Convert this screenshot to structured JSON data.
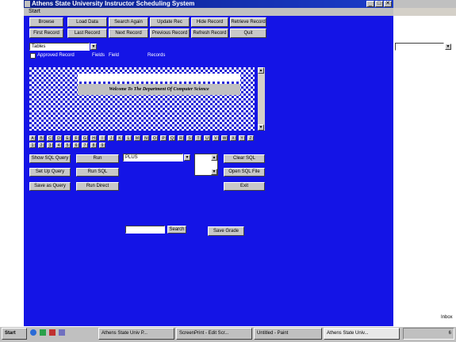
{
  "window": {
    "title": "Athens State University Instructor Scheduling System",
    "controls": [
      "_",
      "□",
      "✕"
    ]
  },
  "menu": {
    "items": [
      "Start"
    ]
  },
  "toolbar": {
    "row1": [
      "Browse",
      "Load Data",
      "Search Again",
      "Update Rec",
      "Hide Record",
      "Retrieve Record"
    ],
    "row2": [
      "First Record",
      "Last Record",
      "Next Record",
      "Previous Record",
      "Refresh Record",
      "Quit"
    ]
  },
  "filters": {
    "table_select": "Tables",
    "checkbox_label": "Approved Record",
    "fields_label": "Fields",
    "fields_value": "Field",
    "records_label": "Records"
  },
  "banner": {
    "text": "Welcome To The Department Of Computer Science"
  },
  "alphabet": {
    "row1": [
      "A",
      "B",
      "C",
      "D",
      "E",
      "F",
      "G",
      "H",
      "I",
      "J",
      "K",
      "L",
      "M",
      "N",
      "O",
      "P",
      "Q",
      "R",
      "S",
      "T",
      "U",
      "V",
      "W",
      "X",
      "Y",
      "Z"
    ],
    "row2": [
      "1",
      "2",
      "3",
      "4",
      "5",
      "6",
      "7",
      "8",
      "9"
    ]
  },
  "actions": {
    "left": [
      "Show SQL Query",
      "Set Up Query",
      "Save as Query"
    ],
    "middle": [
      "Run",
      "Run SQL",
      "Run Direct"
    ],
    "combo_value": "PLUS",
    "right": [
      "Clear SQL",
      "Open SQL File",
      "Exit"
    ]
  },
  "search": {
    "input_value": "",
    "go_label": "Search",
    "save_label": "Save Grade"
  },
  "right_panel": {
    "item": "Inbox"
  },
  "taskbar": {
    "start": "Start",
    "tasks": [
      "Athens State Univ P...",
      "ScreenPrint - Edit Scr...",
      "Untitled - Paint",
      "Athens State Univ..."
    ],
    "clock": "6"
  },
  "colors": {
    "form_bg": "#1414e6",
    "title_bg": "#0a1f8c",
    "button": "#c8c8c8"
  }
}
